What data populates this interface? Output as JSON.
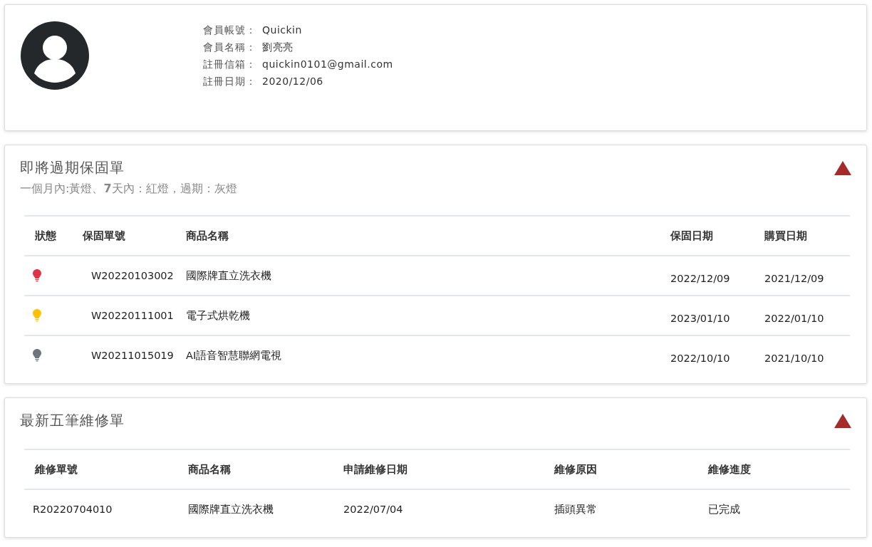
{
  "profile": {
    "fields": [
      {
        "label": "會員帳號：",
        "value": "Quickin"
      },
      {
        "label": "會員名稱：",
        "value": "劉亮亮"
      },
      {
        "label": "註冊信箱：",
        "value": "quickin0101@gmail.com"
      },
      {
        "label": "註冊日期：",
        "value": "2020/12/06"
      }
    ]
  },
  "warranty": {
    "title": "即將過期保固單",
    "subtitle": "一個月內:黃燈、**7**天內：紅燈，過期：灰燈",
    "expanded": true,
    "columns": [
      "狀態",
      "保固單號",
      "商品名稱",
      "保固日期",
      "購買日期"
    ],
    "rows": [
      {
        "color": "#dc3545",
        "number": "W20220103002",
        "product": "國際牌直立洗衣機",
        "warranty_date": "2022/12/09",
        "purchase_date": "2021/12/09"
      },
      {
        "color": "#ffc107",
        "number": "W20220111001",
        "product": "電子式烘乾機",
        "warranty_date": "2023/01/10",
        "purchase_date": "2022/01/10"
      },
      {
        "color": "#6c757d",
        "number": "W20211015019",
        "product": "AI語音智慧聯網電視",
        "warranty_date": "2022/10/10",
        "purchase_date": "2021/10/10"
      }
    ]
  },
  "repairs": {
    "title": "最新五筆維修單",
    "expanded": true,
    "columns": [
      "維修單號",
      "商品名稱",
      "申請維修日期",
      "維修原因",
      "維修進度"
    ],
    "rows": [
      {
        "number": "R20220704010",
        "product": "國際牌直立洗衣機",
        "date": "2022/07/04",
        "reason": "插頭異常",
        "progress": "已完成"
      }
    ]
  }
}
